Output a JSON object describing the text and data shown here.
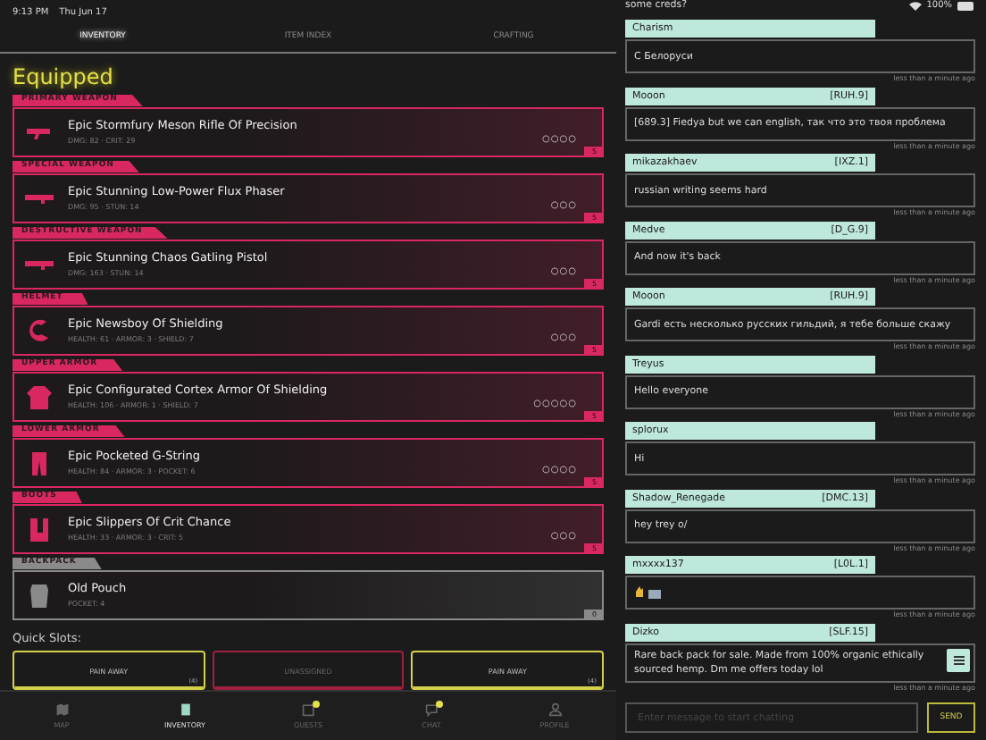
{
  "status_bar": {
    "time": "9:13 PM",
    "date": "Thu Jun 17",
    "battery": "100%"
  },
  "tabs": [
    {
      "label": "INVENTORY",
      "selected": true
    },
    {
      "label": "ITEM INDEX",
      "selected": false
    },
    {
      "label": "CRAFTING",
      "selected": false
    }
  ],
  "section_title": "Equipped",
  "slots": [
    {
      "kind": "equipped",
      "slot": "PRIMARY WEAPON",
      "name": "Epic Stormfury Meson Rifle Of Precision",
      "stats": "DMG: 82 · CRIT: 29",
      "sockets": "○○○○",
      "badge": "5"
    },
    {
      "kind": "equipped",
      "slot": "SPECIAL WEAPON",
      "name": "Epic Stunning Low-Power Flux Phaser",
      "stats": "DMG: 95 · STUN: 14",
      "sockets": "○○○",
      "badge": "5"
    },
    {
      "kind": "equipped",
      "slot": "DESTRUCTIVE WEAPON",
      "name": "Epic Stunning Chaos Gatling Pistol",
      "stats": "DMG: 163 · STUN: 14",
      "sockets": "○○○",
      "badge": "5"
    },
    {
      "kind": "equipped",
      "slot": "HELMET",
      "name": "Epic Newsboy Of Shielding",
      "stats": "HEALTH: 61 · ARMOR: 3 · SHIELD: 7",
      "sockets": "○○○",
      "badge": "5"
    },
    {
      "kind": "equipped",
      "slot": "UPPER ARMOR",
      "name": "Epic Configurated Cortex Armor Of Shielding",
      "stats": "HEALTH: 106 · ARMOR: 1 · SHIELD: 7",
      "sockets": "○○○○○",
      "badge": "5"
    },
    {
      "kind": "equipped",
      "slot": "LOWER ARMOR",
      "name": "Epic Pocketed G-String",
      "stats": "HEALTH: 84 · ARMOR: 3 · POCKET: 6",
      "sockets": "○○○○",
      "badge": "5"
    },
    {
      "kind": "equipped",
      "slot": "BOOTS",
      "name": "Epic Slippers Of Crit Chance",
      "stats": "HEALTH: 33 · ARMOR: 3 · CRIT: 5",
      "sockets": "○○○",
      "badge": "5"
    },
    {
      "kind": "backpack",
      "slot": "BACKPACK",
      "name": "Old Pouch",
      "stats": "POCKET: 4",
      "badge": "0"
    }
  ],
  "quick_slots_label": "Quick Slots:",
  "quick_slots": [
    {
      "kind": "filled",
      "label": "PAIN AWAY",
      "count": "(4)"
    },
    {
      "kind": "empty",
      "label": "UNASSIGNED"
    },
    {
      "kind": "filled",
      "label": "PAIN AWAY",
      "count": "(4)"
    }
  ],
  "nav": [
    {
      "label": "MAP",
      "selected": false,
      "alert": false
    },
    {
      "label": "INVENTORY",
      "selected": true,
      "alert": false
    },
    {
      "label": "QUESTS",
      "selected": false,
      "alert": true
    },
    {
      "label": "CHAT",
      "selected": false,
      "alert": true
    },
    {
      "label": "PROFILE",
      "selected": false,
      "alert": false
    }
  ],
  "chat": {
    "previous_text": "some creds?",
    "messages": [
      {
        "kind": "text",
        "user": "Charism",
        "text": "С Белоруси",
        "time": "less than a minute ago"
      },
      {
        "kind": "text",
        "user": "Mooon",
        "tag": "[RUH.9]",
        "text": "[689.3] Fiedya  but we can english, так что это твоя проблема",
        "time": "less than a minute ago"
      },
      {
        "kind": "text",
        "user": "mikazakhaev",
        "tag": "[IXZ.1]",
        "text": "russian writing seems hard",
        "time": "less than a minute ago"
      },
      {
        "kind": "text",
        "user": "Medve",
        "tag": "[D_G.9]",
        "text": "And now it's back",
        "time": "less than a minute ago"
      },
      {
        "kind": "text",
        "user": "Mooon",
        "tag": "[RUH.9]",
        "text": "Gardi  есть несколько русских гильдий, я тебе больше скажу",
        "time": "less than a minute ago"
      },
      {
        "kind": "text",
        "user": "Treyus",
        "text": "Hello everyone",
        "time": "less than a minute ago"
      },
      {
        "kind": "text",
        "user": "splorux",
        "text": "Hi",
        "time": "less than a minute ago"
      },
      {
        "kind": "text",
        "user": "Shadow_Renegade",
        "tag": "[DMC.13]",
        "text": "hey trey o/",
        "time": "less than a minute ago"
      },
      {
        "kind": "emoji",
        "user": "mxxxx137",
        "tag": "[L0L.1]",
        "time": "less than a minute ago"
      },
      {
        "kind": "text",
        "user": "Dizko",
        "tag": "[SLF.15]",
        "text": "Rare back pack for sale. Made from 100% organic ethically sourced hemp. Dm me offers today lol",
        "time": "less than a minute ago"
      }
    ],
    "input_placeholder": "Enter message to start chatting",
    "send_label": "SEND"
  }
}
